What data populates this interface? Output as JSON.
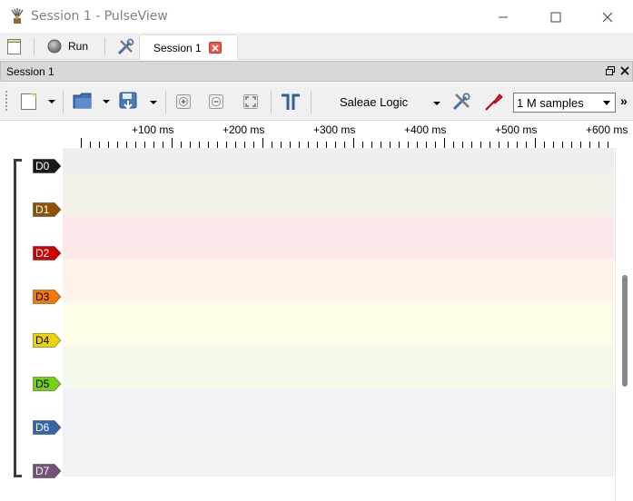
{
  "window": {
    "title": "Session 1 - PulseView",
    "app_icon": "pulseview-icon",
    "minimize_icon": "minimize-icon",
    "maximize_icon": "maximize-icon",
    "close_icon": "close-icon"
  },
  "main_toolbar": {
    "new_session_icon": "new-session-icon",
    "run_label": "Run",
    "settings_icon": "settings-icon",
    "tabs": [
      {
        "label": "Session 1",
        "close_icon": "tab-close-icon"
      }
    ]
  },
  "session_dock": {
    "title": "Session 1",
    "float_icon": "float-icon",
    "close_icon": "close-icon"
  },
  "session_toolbar": {
    "device": "Saleae Logic",
    "sample_count": "1 M samples",
    "overflow_glyph": "»"
  },
  "ruler": {
    "ticks": [
      "+100 ms",
      "+200 ms",
      "+300 ms",
      "+400 ms",
      "+500 ms",
      "+600 ms"
    ]
  },
  "channels": [
    {
      "name": "D0",
      "color": "#1a1a1a",
      "text_color": "#ffffff",
      "lane_color": "#eeeeee"
    },
    {
      "name": "D1",
      "color": "#8f5202",
      "text_color": "#ffffff",
      "lane_color": "#f3f0ea"
    },
    {
      "name": "D2",
      "color": "#cc0000",
      "text_color": "#ffffff",
      "lane_color": "#fbe9e9"
    },
    {
      "name": "D3",
      "color": "#f57900",
      "text_color": "#000000",
      "lane_color": "#fef3ea"
    },
    {
      "name": "D4",
      "color": "#edd400",
      "text_color": "#000000",
      "lane_color": "#fefde8"
    },
    {
      "name": "D5",
      "color": "#73d216",
      "text_color": "#000000",
      "lane_color": "#f3f9ea"
    },
    {
      "name": "D6",
      "color": "#3465a4",
      "text_color": "#ffffff",
      "lane_color": "#f0f2f7"
    },
    {
      "name": "D7",
      "color": "#75507b",
      "text_color": "#ffffff",
      "lane_color": "#f4f1f5"
    }
  ]
}
